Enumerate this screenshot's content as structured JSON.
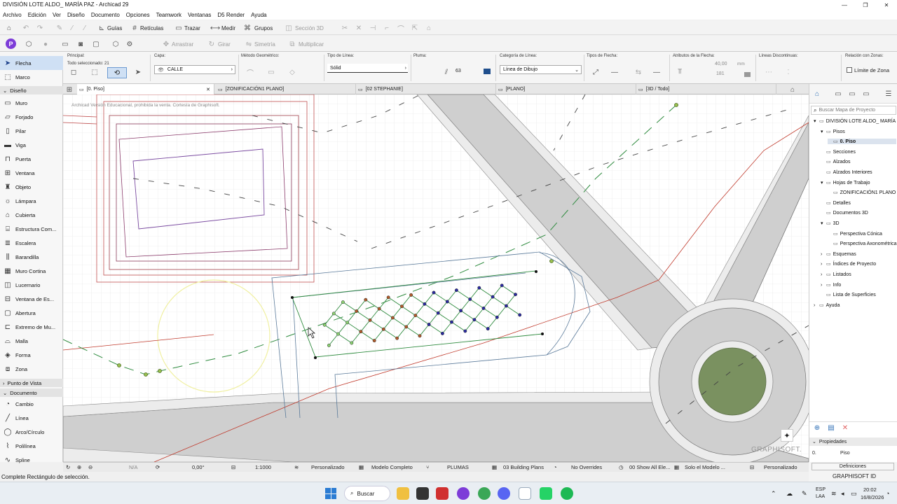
{
  "window": {
    "title": "DIVISIÓN LOTE ALDO_ MARÍA PAZ - Archicad 29",
    "controls": [
      "—",
      "❐",
      "✕"
    ]
  },
  "menu": [
    "Archivo",
    "Edición",
    "Ver",
    "Diseño",
    "Documento",
    "Opciones",
    "Teamwork",
    "Ventanas",
    "D5 Render",
    "Ayuda"
  ],
  "toolbar1": {
    "guias": "Guías",
    "reticulas": "Retículas",
    "trazar": "Trazar",
    "medir": "Medir",
    "grupos": "Grupos",
    "seccion3d": "Sección 3D"
  },
  "toolbar2": {
    "arrastrar": "Arrastrar",
    "girar": "Girar",
    "simetria": "Simetría",
    "multiplicar": "Multiplicar"
  },
  "infobox": {
    "principal_label": "Principal:",
    "selected": "Todo seleccionado: 21",
    "capa_label": "Capa:",
    "capa_value": "CALLE",
    "metodo_label": "Método Geométrico:",
    "tipo_linea_label": "Tipo de Línea:",
    "tipo_linea_value": "Sólid",
    "pluma_label": "Pluma:",
    "pluma_value": "63",
    "categoria_label": "Categoría de Línea:",
    "categoria_value": "Línea de Dibujo",
    "tipos_flecha_label": "Tipos de Flecha:",
    "atributos_label": "Atributos de la Flecha:",
    "arrow_size": "40,00",
    "arrow_unit": "mm",
    "arrow_angle": "181",
    "discontinuas_label": "Líneas Discontinuas:",
    "zonas_label": "Relación con Zonas:",
    "limite_zona": "Límite de Zona"
  },
  "toolbox": {
    "top_items": [
      {
        "icon": "arrow-icon",
        "label": "Flecha",
        "selected": true
      },
      {
        "icon": "marquee-icon",
        "label": "Marco",
        "selected": false
      }
    ],
    "section_design": "Diseño",
    "design_items": [
      {
        "icon": "wall-icon",
        "label": "Muro"
      },
      {
        "icon": "slab-icon",
        "label": "Forjado"
      },
      {
        "icon": "column-icon",
        "label": "Pilar"
      },
      {
        "icon": "beam-icon",
        "label": "Viga"
      },
      {
        "icon": "door-icon",
        "label": "Puerta"
      },
      {
        "icon": "window-icon",
        "label": "Ventana"
      },
      {
        "icon": "object-icon",
        "label": "Objeto"
      },
      {
        "icon": "lamp-icon",
        "label": "Lámpara"
      },
      {
        "icon": "roof-icon",
        "label": "Cubierta"
      },
      {
        "icon": "structure-icon",
        "label": "Estructura Com..."
      },
      {
        "icon": "stair-icon",
        "label": "Escalera"
      },
      {
        "icon": "railing-icon",
        "label": "Barandilla"
      },
      {
        "icon": "curtainwall-icon",
        "label": "Muro Cortina"
      },
      {
        "icon": "skylight-icon",
        "label": "Lucernario"
      },
      {
        "icon": "corner-window-icon",
        "label": "Ventana de Es..."
      },
      {
        "icon": "opening-icon",
        "label": "Abertura"
      },
      {
        "icon": "wall-end-icon",
        "label": "Extremo de Mu..."
      },
      {
        "icon": "mesh-icon",
        "label": "Malla"
      },
      {
        "icon": "morph-icon",
        "label": "Forma"
      },
      {
        "icon": "zone-icon",
        "label": "Zona"
      }
    ],
    "section_viewpoint": "Punto de Vista",
    "section_document": "Documento",
    "document_items": [
      {
        "icon": "change-icon",
        "label": "Cambio"
      },
      {
        "icon": "line-icon",
        "label": "Línea"
      },
      {
        "icon": "arc-icon",
        "label": "Arco/Círculo"
      },
      {
        "icon": "polyline-icon",
        "label": "Polilínea"
      },
      {
        "icon": "spline-icon",
        "label": "Spline"
      }
    ]
  },
  "tabs": [
    {
      "label": "[0. Piso]",
      "active": true,
      "close": "✕"
    },
    {
      "label": "[ZONIFICACIÓN1 PLANO]",
      "active": false
    },
    {
      "label": "[02 STEPHANIE]",
      "active": false
    },
    {
      "label": "[PLANO]",
      "active": false
    },
    {
      "label": "[3D / Todo]",
      "active": false
    }
  ],
  "canvas": {
    "watermark": "Archicad Versión Educacional, prohibida la venta. Cortesía de Graphisoft.",
    "brand": "GRAPHISOFT."
  },
  "navigator": {
    "search_placeholder": "Buscar Mapa de Proyecto",
    "tree": [
      {
        "label": "DIVISIÓN LOTE ALDO_ MARÍA",
        "level": 0,
        "expand": "▾"
      },
      {
        "label": "Pisos",
        "level": 1,
        "expand": "▾"
      },
      {
        "label": "0. Piso",
        "level": 2,
        "expand": "",
        "selected": true
      },
      {
        "label": "Secciones",
        "level": 1,
        "expand": ""
      },
      {
        "label": "Alzados",
        "level": 1,
        "expand": ""
      },
      {
        "label": "Alzados Interiores",
        "level": 1,
        "expand": ""
      },
      {
        "label": "Hojas de Trabajo",
        "level": 1,
        "expand": "▾"
      },
      {
        "label": "ZONIFICACIÓN1 PLANO (",
        "level": 2,
        "expand": ""
      },
      {
        "label": "Detalles",
        "level": 1,
        "expand": ""
      },
      {
        "label": "Documentos 3D",
        "level": 1,
        "expand": ""
      },
      {
        "label": "3D",
        "level": 1,
        "expand": "▾"
      },
      {
        "label": "Perspectiva Cónica",
        "level": 2,
        "expand": ""
      },
      {
        "label": "Perspectiva Axonométrica",
        "level": 2,
        "expand": ""
      },
      {
        "label": "Esquemas",
        "level": 1,
        "expand": "›"
      },
      {
        "label": "Índices de Proyecto",
        "level": 1,
        "expand": "›"
      },
      {
        "label": "Listados",
        "level": 1,
        "expand": "›"
      },
      {
        "label": "Info",
        "level": 1,
        "expand": "›"
      },
      {
        "label": "Lista de Superficies",
        "level": 1,
        "expand": ""
      },
      {
        "label": "Ayuda",
        "level": 0,
        "expand": "›"
      }
    ],
    "properties_label": "Propiedades",
    "prop_index": "0.",
    "prop_value": "Piso",
    "definiciones": "Definiciones",
    "graphisoft_id": "GRAPHISOFT ID"
  },
  "statusbar": {
    "na": "N/A",
    "angle": "0,00°",
    "scale": "1:1000",
    "personalizado": "Personalizado",
    "modelo": "Modelo Completo",
    "plumas": "PLUMAS",
    "building_plans": "03 Building Plans",
    "overrides": "No Overrides",
    "show_all": "00 Show All Ele...",
    "solo_modelo": "Solo el Modelo ...",
    "personalizado2": "Personalizado"
  },
  "hint": "Complete Rectángulo de selección.",
  "taskbar": {
    "search": "Buscar",
    "lang1": "ESP",
    "lang2": "LAA",
    "time": "20:02",
    "date": "16/8/2026"
  },
  "colors": {
    "accent": "#2f6fb5",
    "road_fill": "#cfcfcf",
    "red_line": "#c0392b",
    "green_line": "#2e8b3e",
    "roundabout": "#7a9160"
  }
}
